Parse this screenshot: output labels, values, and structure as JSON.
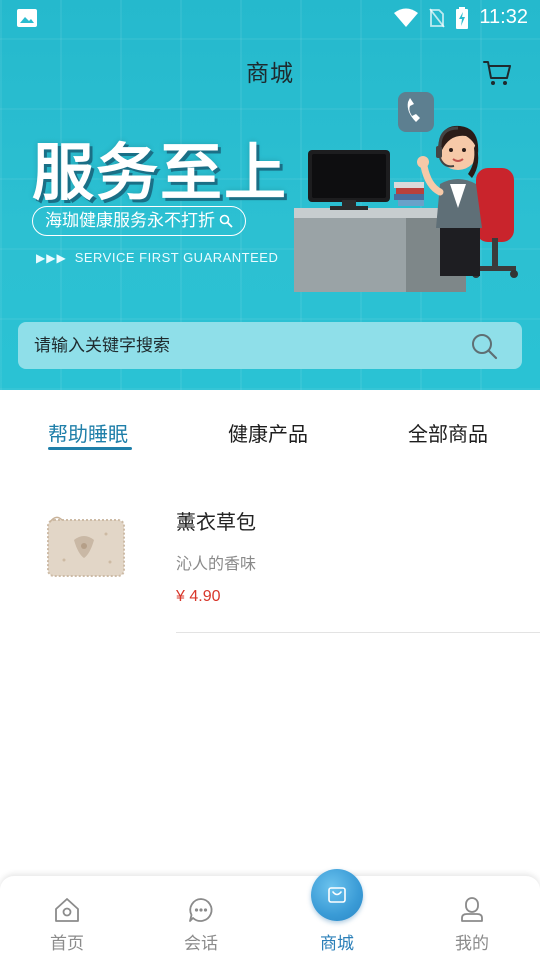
{
  "status_bar": {
    "time": "11:32",
    "icons": [
      "image-icon",
      "wifi-icon",
      "no-sim-icon",
      "battery-charging-icon"
    ]
  },
  "header": {
    "title": "商城",
    "cart_icon": "cart-icon"
  },
  "banner": {
    "headline": "服务至上",
    "pill_text": "海珈健康服务永不打折",
    "service_text": "SERVICE FIRST  GUARANTEED",
    "colors": {
      "background": "#2ac2d4",
      "headline": "#ffffff"
    }
  },
  "search": {
    "placeholder": "请输入关键字搜索",
    "value": ""
  },
  "tabs": {
    "items": [
      {
        "label": "帮助睡眠",
        "active": true
      },
      {
        "label": "健康产品",
        "active": false
      },
      {
        "label": "全部商品",
        "active": false
      }
    ],
    "active_color": "#1f7fa9"
  },
  "products": [
    {
      "name": "薰衣草包",
      "description": "沁人的香味",
      "price": "¥ 4.90",
      "image_icon": "lavender-sachet-image"
    }
  ],
  "bottom_nav": {
    "items": [
      {
        "label": "首页",
        "icon": "home-icon",
        "active": false
      },
      {
        "label": "会话",
        "icon": "chat-icon",
        "active": false
      },
      {
        "label": "商城",
        "icon": "shopping-bag-icon",
        "active": true
      },
      {
        "label": "我的",
        "icon": "user-icon",
        "active": false
      }
    ],
    "active_color": "#2b7fb8",
    "inactive_color": "#8b8b8b"
  }
}
